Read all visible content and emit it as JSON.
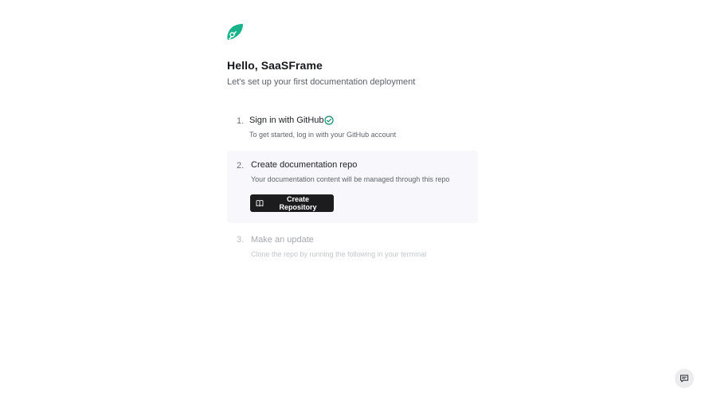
{
  "header": {
    "greeting": "Hello, SaaSFrame",
    "subtitle": "Let's set up your first documentation deployment"
  },
  "steps": [
    {
      "number": "1.",
      "title": "Sign in with GitHub",
      "description": "To get started, log in with your GitHub account",
      "status": "completed",
      "icon": "check-circle-icon"
    },
    {
      "number": "2.",
      "title": "Create documentation repo",
      "description": "Your documentation content will be managed through this repo",
      "status": "active",
      "button_label": "Create Repository",
      "button_icon": "book-icon"
    },
    {
      "number": "3.",
      "title": "Make an update",
      "description": "Clone the repo by running the following in your terminal",
      "status": "pending"
    }
  ],
  "colors": {
    "brand": "#17b38a",
    "check": "#0f8a6a",
    "button_bg": "#1c1c1f",
    "active_step_bg": "#f8f7fb"
  },
  "icons": {
    "logo": "leaf-rocket-logo-icon",
    "feedback": "chat-feedback-icon"
  }
}
